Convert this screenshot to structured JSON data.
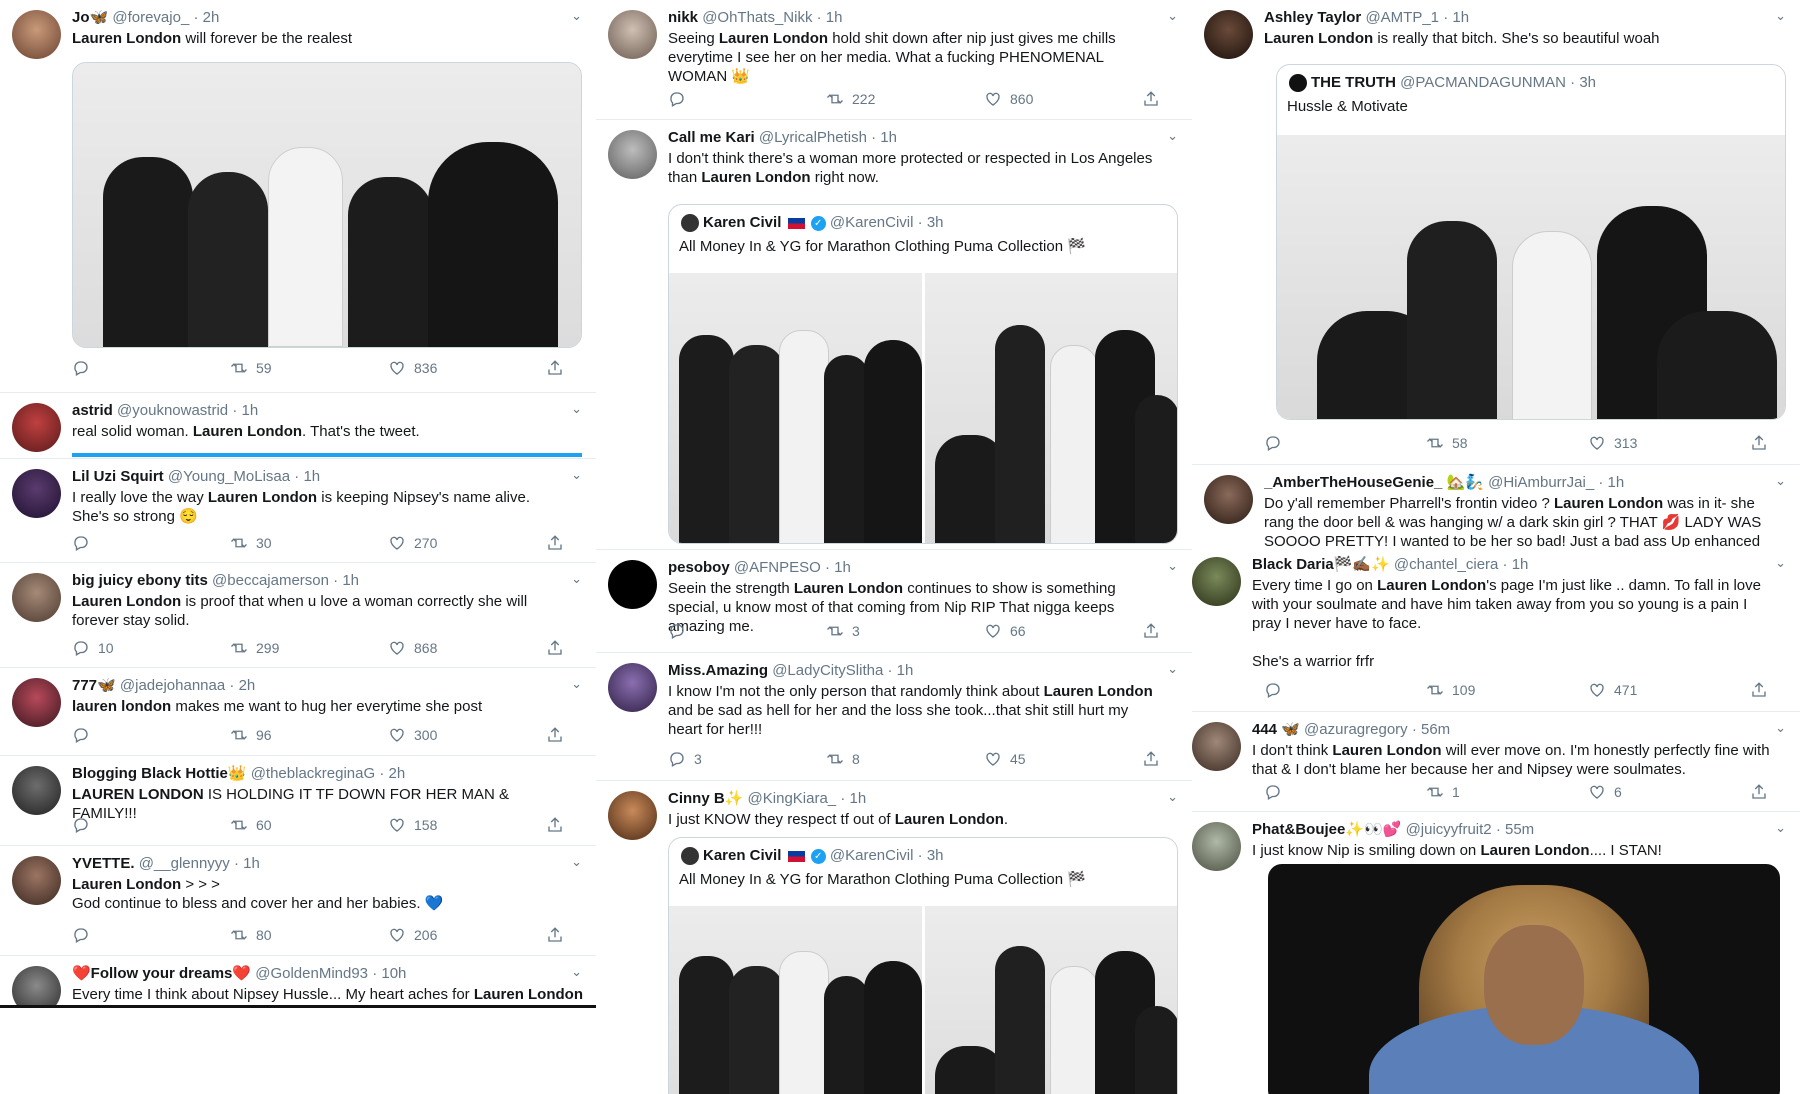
{
  "col1": [
    {
      "name": "Jo🦋",
      "handle": "@forevajo_",
      "time": "2h",
      "text_b": "Lauren London",
      "text_a": " will forever be the realest",
      "replies": "",
      "retweets": "59",
      "likes": "836"
    },
    {
      "name": "astrid",
      "handle": "@youknowastrid",
      "time": "1h",
      "text_b": "",
      "text_pre": "real solid woman. ",
      "text_hl": "Lauren London",
      "text_post": ". That's the tweet."
    },
    {
      "name": "Lil Uzi Squirt",
      "handle": "@Young_MoLisaa",
      "time": "1h",
      "text_pre": "I really love the way ",
      "text_hl": "Lauren London",
      "text_post": " is keeping Nipsey's name alive. She's so strong 😌",
      "replies": "",
      "retweets": "30",
      "likes": "270"
    },
    {
      "name": "big juicy ebony tits",
      "handle": "@beccajamerson",
      "time": "1h",
      "text_pre": "",
      "text_hl": "Lauren London",
      "text_post": " is proof that when u love a woman correctly she will forever stay solid.",
      "replies": "10",
      "retweets": "299",
      "likes": "868"
    },
    {
      "name": "777🦋",
      "handle": "@jadejohannaa",
      "time": "2h",
      "text_pre": "",
      "text_hl": "lauren london",
      "text_post": " makes me want to hug her everytime she post",
      "replies": "",
      "retweets": "96",
      "likes": "300"
    },
    {
      "name": "Blogging Black Hottie👑",
      "handle": "@theblackreginaG",
      "time": "2h",
      "text_pre": "",
      "text_hl": "LAUREN LONDON",
      "text_post": " IS HOLDING IT TF DOWN FOR HER MAN & FAMILY!!!",
      "replies": "",
      "retweets": "60",
      "likes": "158"
    },
    {
      "name": "YVETTE.",
      "handle": "@__glennyyy",
      "time": "1h",
      "text_pre": "",
      "text_hl": "Lauren London",
      "text_post": " > > >",
      "text_line2": "God continue to bless and cover her and her babies. 💙",
      "replies": "",
      "retweets": "80",
      "likes": "206"
    },
    {
      "name": "❤️Follow your dreams❤️",
      "handle": "@GoldenMind93",
      "time": "10h",
      "text_pre": "Every time I think about Nipsey Hussle... My heart aches for ",
      "text_hl": "Lauren London",
      "text_post": ""
    }
  ],
  "col2": [
    {
      "name": "nikk",
      "handle": "@OhThats_Nikk",
      "time": "1h",
      "text_pre": "Seeing ",
      "text_hl": "Lauren London",
      "text_post": " hold shit down after nip just gives me chills everytime I see her on her media. What a fucking PHENOMENAL WOMAN 👑",
      "replies": "",
      "retweets": "222",
      "likes": "860"
    },
    {
      "name": "Call me Kari",
      "handle": "@LyricalPhetish",
      "time": "1h",
      "text_pre": "I don't think there's a woman more protected or respected in Los Angeles than ",
      "text_hl": "Lauren London",
      "text_post": " right now.",
      "quote": {
        "name": "Karen Civil",
        "handle": "@KarenCivil",
        "time": "3h",
        "text": "All Money In & YG for Marathon Clothing Puma Collection 🏁"
      }
    },
    {
      "name": "pesoboy",
      "handle": "@AFNPESO",
      "time": "1h",
      "text_pre": "Seein the strength ",
      "text_hl": "Lauren London",
      "text_post": " continues to show is something special, u know most of that coming from Nip RIP That nigga keeps amazing me.",
      "replies": "",
      "retweets": "3",
      "likes": "66"
    },
    {
      "name": "Miss.Amazing",
      "handle": "@LadyCitySlitha",
      "time": "1h",
      "text_pre": "I know I'm not the only person that randomly think about ",
      "text_hl": "Lauren London",
      "text_post": " and be sad as hell for her and the loss she took...that shit still hurt my heart for her!!!",
      "replies": "3",
      "retweets": "8",
      "likes": "45"
    },
    {
      "name": "Cinny B✨",
      "handle": "@KingKiara_",
      "time": "1h",
      "text_pre": "I just KNOW they respect tf out of ",
      "text_hl": "Lauren London",
      "text_post": ".",
      "quote": {
        "name": "Karen Civil",
        "handle": "@KarenCivil",
        "time": "3h",
        "text": "All Money In & YG for Marathon Clothing Puma Collection 🏁"
      }
    }
  ],
  "col3": [
    {
      "name": "Ashley Taylor",
      "handle": "@AMTP_1",
      "time": "1h",
      "text_pre": "",
      "text_hl": "Lauren London",
      "text_post": " is really that bitch. She's so beautiful woah",
      "quote": {
        "name": "THE TRUTH",
        "handle": "@PACMANDAGUNMAN",
        "time": "3h",
        "text": "Hussle & Motivate"
      },
      "replies": "",
      "retweets": "58",
      "likes": "313"
    },
    {
      "name": "_AmberTheHouseGenie_ 🏡🧞",
      "handle": "@HiAmburrJai_",
      "time": "1h",
      "text_pre": "Do y'all remember Pharrell's frontin video ? ",
      "text_hl": "Lauren London",
      "text_post": " was in it- she rang the door bell & was hanging w/ a dark skin girl ? THAT 💋 LADY WAS SOOOO PRETTY! I wanted to be her so bad! Just a bad ass Up enhanced"
    },
    {
      "name": "Black Daria🏁✍🏾✨",
      "handle": "@chantel_ciera",
      "time": "1h",
      "text_pre": "Every time I go on ",
      "text_hl": "Lauren London",
      "text_post": "'s page I'm just like .. damn. To fall in love with your soulmate and have him taken away from you so young is a pain I pray I never have to face.",
      "text_line2": "She's a warrior frfr",
      "replies": "",
      "retweets": "109",
      "likes": "471"
    },
    {
      "name": "444 🦋",
      "handle": "@azuragregory",
      "time": "56m",
      "text_pre": "I don't think ",
      "text_hl": "Lauren London",
      "text_post": " will ever move on. I'm honestly perfectly fine with that & I don't blame her because her and Nipsey were soulmates.",
      "replies": "",
      "retweets": "1",
      "likes": "6"
    },
    {
      "name": "Phat&Boujee✨👀💕",
      "handle": "@juicyyfruit2",
      "time": "55m",
      "text_pre": "I just know Nip is smiling down on ",
      "text_hl": "Lauren London",
      "text_post": ".... I STAN!"
    }
  ],
  "icons": {
    "reply": "reply-icon",
    "retweet": "retweet-icon",
    "like": "heart-icon",
    "share": "share-icon",
    "menu": "chevron-down-icon"
  },
  "colors": {
    "text": "#14171a",
    "muted": "#657786",
    "border": "#e6ecf0",
    "accent": "#1da1f2"
  }
}
